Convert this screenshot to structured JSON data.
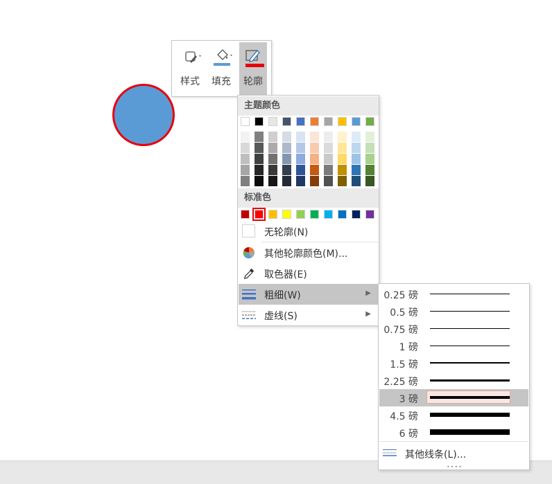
{
  "toolbar": {
    "style_label": "样式",
    "fill_label": "填充",
    "outline_label": "轮廓",
    "fill_color": "#5b9bd5",
    "outline_color": "#e8000b"
  },
  "dropdown": {
    "theme_header": "主题颜色",
    "standard_header": "标准色",
    "theme_top": [
      "#ffffff",
      "#000000",
      "#e7e6e6",
      "#44546a",
      "#4472c4",
      "#ed7d31",
      "#a5a5a5",
      "#ffc000",
      "#5b9bd5",
      "#70ad47"
    ],
    "theme_shades": [
      [
        "#f2f2f2",
        "#d9d9d9",
        "#bfbfbf",
        "#a6a6a6",
        "#808080"
      ],
      [
        "#808080",
        "#595959",
        "#404040",
        "#262626",
        "#0d0d0d"
      ],
      [
        "#d0cece",
        "#aeaaaa",
        "#757171",
        "#3b3838",
        "#171616"
      ],
      [
        "#d6dce4",
        "#adb9ca",
        "#8497b0",
        "#333f4f",
        "#222a35"
      ],
      [
        "#dae3f3",
        "#b4c7e7",
        "#8faadc",
        "#2f5597",
        "#203864"
      ],
      [
        "#fbe5d6",
        "#f8cbad",
        "#f4b183",
        "#c55a11",
        "#843c0c"
      ],
      [
        "#ededed",
        "#dbdbdb",
        "#c9c9c9",
        "#7b7b7b",
        "#525252"
      ],
      [
        "#fff2cc",
        "#ffe699",
        "#ffd966",
        "#bf9000",
        "#7f6000"
      ],
      [
        "#deebf7",
        "#bdd7ee",
        "#9dc3e6",
        "#2e75b6",
        "#1f4e79"
      ],
      [
        "#e2f0d9",
        "#c5e0b4",
        "#a9d18e",
        "#548235",
        "#385723"
      ]
    ],
    "standard_colors": [
      "#c00000",
      "#ff0000",
      "#ffc000",
      "#ffff00",
      "#92d050",
      "#00b050",
      "#00b0f0",
      "#0070c0",
      "#002060",
      "#7030a0"
    ],
    "no_outline": "无轮廓(N)",
    "more_colors": "其他轮廓颜色(M)...",
    "eyedropper": "取色器(E)",
    "weight": "粗细(W)",
    "dashes": "虚线(S)"
  },
  "weights": {
    "items": [
      {
        "label": "0.25 磅",
        "value": 0.25
      },
      {
        "label": "0.5 磅",
        "value": 0.5
      },
      {
        "label": "0.75 磅",
        "value": 0.75
      },
      {
        "label": "1 磅",
        "value": 1
      },
      {
        "label": "1.5 磅",
        "value": 1.5
      },
      {
        "label": "2.25 磅",
        "value": 2.25
      },
      {
        "label": "3 磅",
        "value": 3
      },
      {
        "label": "4.5 磅",
        "value": 4.5
      },
      {
        "label": "6 磅",
        "value": 6
      }
    ],
    "selected": "3 磅",
    "more_lines": "其他线条(L)..."
  }
}
